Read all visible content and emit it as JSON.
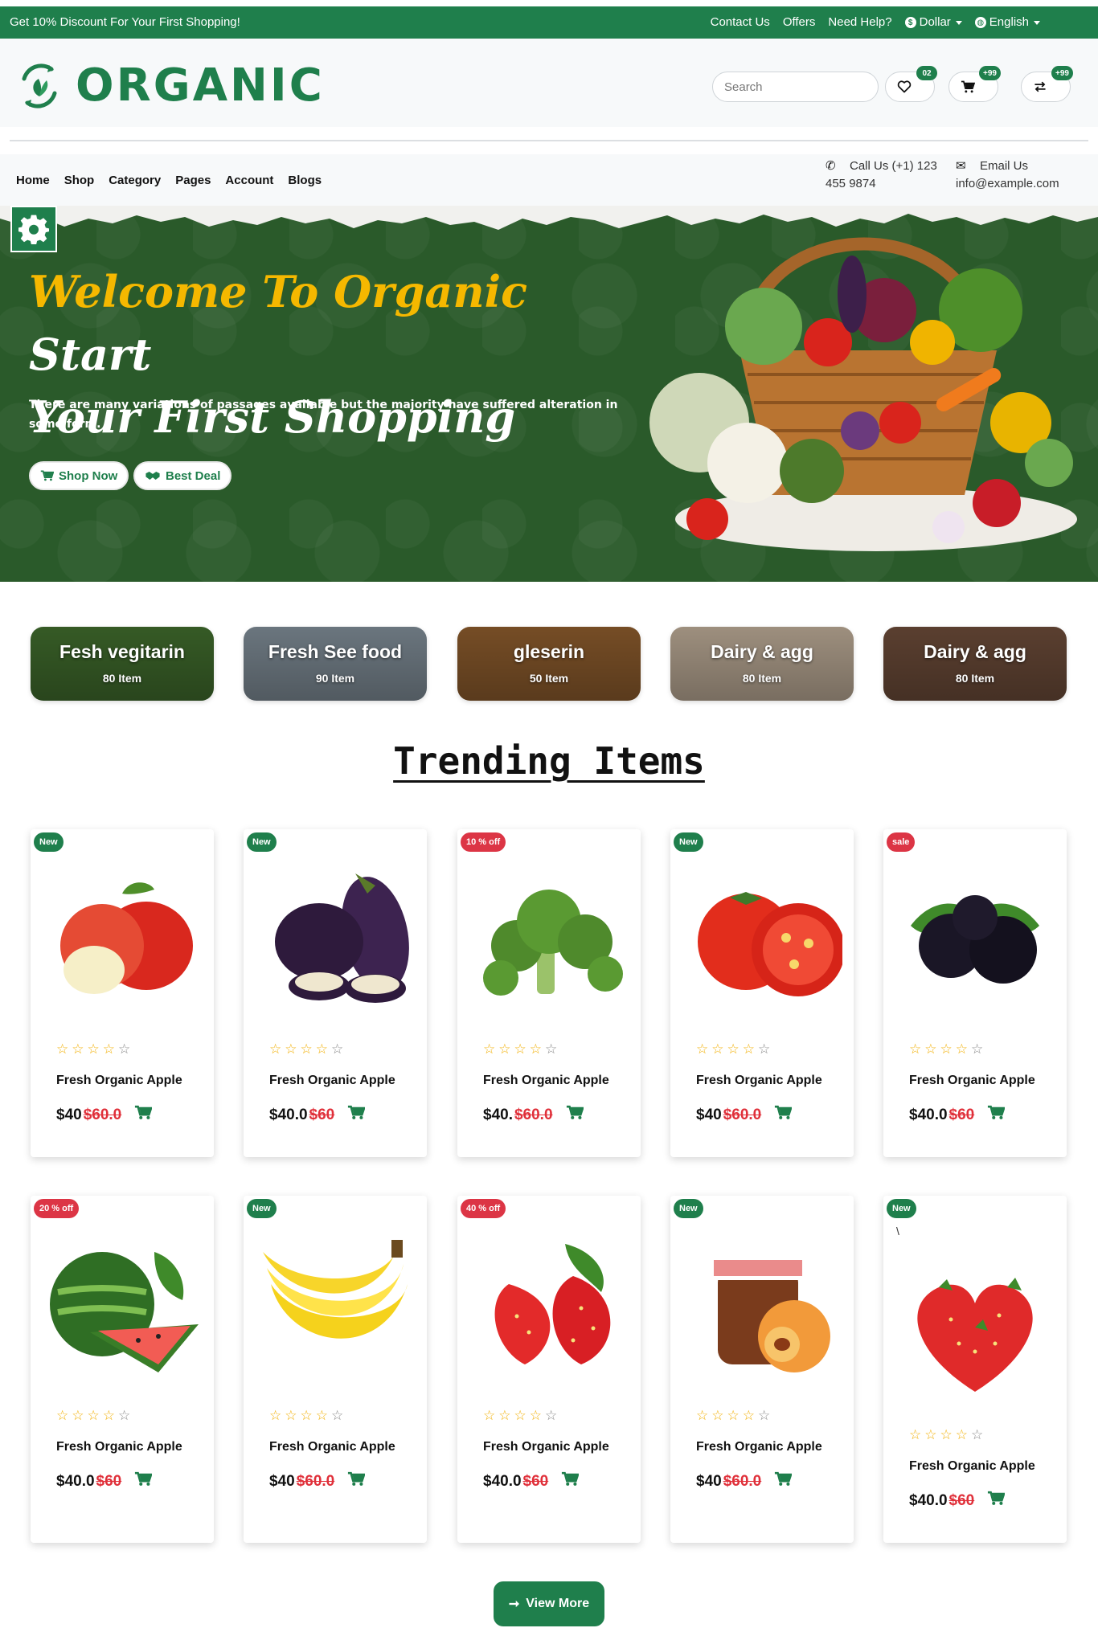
{
  "topbar": {
    "promo": "Get 10% Discount For Your First Shopping!",
    "links": [
      "Contact Us",
      "Offers",
      "Need Help?"
    ],
    "currency": "Dollar",
    "language": "English"
  },
  "header": {
    "logo_text": "ORGANIC",
    "search_placeholder": "Search",
    "wishlist_count": "02",
    "cart_count": "+99",
    "compare_count": "+99"
  },
  "nav": {
    "items": [
      "Home",
      "Shop",
      "Category",
      "Pages",
      "Account",
      "Blogs"
    ],
    "call_label": "Call Us (+1) 123",
    "call_number": "455 9874",
    "email_label": "Email Us",
    "email_value": "info@example.com"
  },
  "hero": {
    "title_accent": "Welcome To Organic",
    "title_rest_1": "Start",
    "title_rest_2": "Your First Shopping",
    "description": "There are many variations of passages available but the majority have suffered alteration in some form.",
    "btn_shop": "Shop Now",
    "btn_deal": "Best Deal"
  },
  "categories": [
    {
      "name": "Fesh vegitarin",
      "count": "80 Item",
      "bg": "#3f6a2c"
    },
    {
      "name": "Fresh See food",
      "count": "90 Item",
      "bg": "#7d8a94"
    },
    {
      "name": "gleserin",
      "count": "50 Item",
      "bg": "#8a5a2c"
    },
    {
      "name": "Dairy & agg",
      "count": "80 Item",
      "bg": "#b9a894"
    },
    {
      "name": "Dairy & agg",
      "count": "80 Item",
      "bg": "#6a4a38"
    }
  ],
  "trending": {
    "title": "Trending Items",
    "products": [
      {
        "badge": "New",
        "badge_color": "#1f7f4c",
        "name": "Fresh Organic Apple",
        "price": "$40",
        "old_price": "$60.0",
        "rating": 4,
        "img": "apple"
      },
      {
        "badge": "New",
        "badge_color": "#1f7f4c",
        "name": "Fresh Organic Apple",
        "price": "$40.0",
        "old_price": "$60",
        "rating": 4,
        "img": "eggplant"
      },
      {
        "badge": "10 % off",
        "badge_color": "#dc3545",
        "name": "Fresh Organic Apple",
        "price": "$40.",
        "old_price": "$60.0",
        "rating": 4,
        "img": "broccoli"
      },
      {
        "badge": "New",
        "badge_color": "#1f7f4c",
        "name": "Fresh Organic Apple",
        "price": "$40",
        "old_price": "$60.0",
        "rating": 4,
        "img": "tomato"
      },
      {
        "badge": "sale",
        "badge_color": "#dc3545",
        "name": "Fresh Organic Apple",
        "price": "$40.0",
        "old_price": "$60",
        "rating": 4,
        "img": "blackberry"
      },
      {
        "badge": "20 % off",
        "badge_color": "#dc3545",
        "name": "Fresh Organic Apple",
        "price": "$40.0",
        "old_price": "$60",
        "rating": 4,
        "img": "watermelon"
      },
      {
        "badge": "New",
        "badge_color": "#1f7f4c",
        "name": "Fresh Organic Apple",
        "price": "$40",
        "old_price": "$60.0",
        "rating": 4,
        "img": "banana"
      },
      {
        "badge": "40 % off",
        "badge_color": "#dc3545",
        "name": "Fresh Organic Apple",
        "price": "$40.0",
        "old_price": "$60",
        "rating": 4,
        "img": "strawberry"
      },
      {
        "badge": "New",
        "badge_color": "#1f7f4c",
        "name": "Fresh Organic Apple",
        "price": "$40",
        "old_price": "$60.0",
        "rating": 4,
        "img": "jam"
      },
      {
        "badge": "New",
        "badge_color": "#1f7f4c",
        "name": "Fresh Organic Apple",
        "price": "$40.0",
        "old_price": "$60",
        "rating": 4,
        "img": "heart-strawberry",
        "stray_mark": "\\"
      }
    ]
  },
  "view_more_label": "View More",
  "colors": {
    "brand": "#1f7f4c",
    "accent": "#f5b800",
    "sale": "#dc3545",
    "hero_bg": "#2a5a2a"
  }
}
